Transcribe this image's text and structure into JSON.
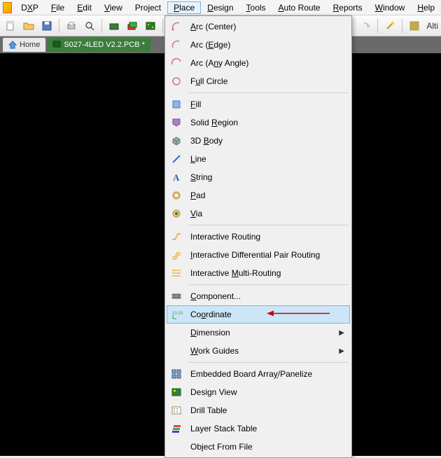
{
  "menubar": {
    "items": [
      {
        "pre": "D",
        "u": "X",
        "post": "P"
      },
      {
        "pre": "",
        "u": "F",
        "post": "ile"
      },
      {
        "pre": "",
        "u": "E",
        "post": "dit"
      },
      {
        "pre": "",
        "u": "V",
        "post": "iew"
      },
      {
        "pre": "Pro",
        "u": "j",
        "post": "ect"
      },
      {
        "pre": "",
        "u": "P",
        "post": "lace"
      },
      {
        "pre": "",
        "u": "D",
        "post": "esign"
      },
      {
        "pre": "",
        "u": "T",
        "post": "ools"
      },
      {
        "pre": "",
        "u": "A",
        "post": "uto Route"
      },
      {
        "pre": "",
        "u": "R",
        "post": "eports"
      },
      {
        "pre": "",
        "u": "W",
        "post": "indow"
      },
      {
        "pre": "",
        "u": "H",
        "post": "elp"
      }
    ],
    "open_index": 5
  },
  "tabs": {
    "home": "Home",
    "file": "S027-4LED V2.2.PCB *"
  },
  "toolbar_right_label": "Alti",
  "dropdown": {
    "highlight_index": 15,
    "items": [
      {
        "icon": "arc-center",
        "pre": "",
        "u": "A",
        "post": "rc (Center)"
      },
      {
        "icon": "arc-edge",
        "pre": "Arc (",
        "u": "E",
        "post": "dge)"
      },
      {
        "icon": "arc-any",
        "pre": "Arc (A",
        "u": "n",
        "post": "y Angle)"
      },
      {
        "icon": "circle",
        "pre": "F",
        "u": "u",
        "post": "ll Circle"
      },
      {
        "sep": true
      },
      {
        "icon": "fill",
        "pre": "",
        "u": "F",
        "post": "ill"
      },
      {
        "icon": "region",
        "pre": "Solid ",
        "u": "R",
        "post": "egion"
      },
      {
        "icon": "body3d",
        "pre": "3D ",
        "u": "B",
        "post": "ody"
      },
      {
        "icon": "line",
        "pre": "",
        "u": "L",
        "post": "ine"
      },
      {
        "icon": "string",
        "pre": "",
        "u": "S",
        "post": "tring"
      },
      {
        "icon": "pad",
        "pre": "",
        "u": "P",
        "post": "ad"
      },
      {
        "icon": "via",
        "pre": "",
        "u": "V",
        "post": "ia"
      },
      {
        "sep": true
      },
      {
        "icon": "route-int",
        "pre": "Interactive Routin",
        "u": "g",
        "post": ""
      },
      {
        "icon": "route-diff",
        "pre": "",
        "u": "I",
        "post": "nteractive Differential Pair Routing"
      },
      {
        "icon": "route-multi",
        "pre": "Interactive ",
        "u": "M",
        "post": "ulti-Routing"
      },
      {
        "sep": true
      },
      {
        "icon": "component",
        "pre": "",
        "u": "C",
        "post": "omponent..."
      },
      {
        "icon": "coord",
        "pre": "Co",
        "u": "o",
        "post": "rdinate",
        "callout": true
      },
      {
        "icon": "submenu",
        "pre": "",
        "u": "D",
        "post": "imension",
        "submenu": true
      },
      {
        "icon": "submenu",
        "pre": "",
        "u": "W",
        "post": "ork Guides",
        "submenu": true
      },
      {
        "sep": true
      },
      {
        "icon": "panel",
        "pre": "Embedded Board Arra",
        "u": "y",
        "post": "/Panelize"
      },
      {
        "icon": "design-view",
        "pre": "Design View",
        "u": "",
        "post": ""
      },
      {
        "icon": "drill",
        "pre": "Drill Table",
        "u": "",
        "post": ""
      },
      {
        "icon": "layer",
        "pre": "Layer Stack Table",
        "u": "",
        "post": ""
      },
      {
        "icon": "object-file",
        "pre": "Object From File",
        "u": "",
        "post": ""
      }
    ]
  }
}
